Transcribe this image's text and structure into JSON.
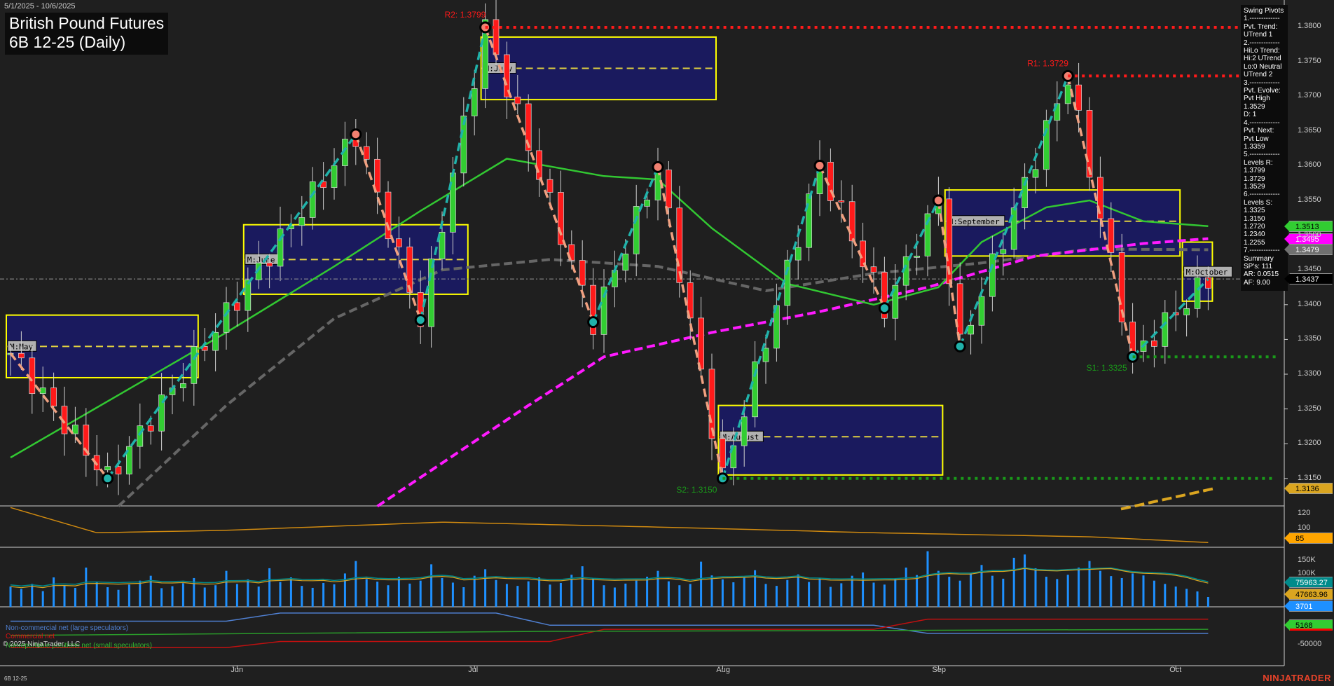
{
  "header": {
    "date_range": "5/1/2025 - 10/6/2025",
    "title_line1": "British Pound Futures",
    "title_line2": "6B 12-25 (Daily)"
  },
  "info_panel": [
    "Swing Pivots",
    "1.-------------",
    "Pvt. Trend:",
    "UTrend 1",
    "2.-------------",
    "HiLo Trend:",
    "Hi:2 UTrend",
    "Lo:0 Neutral",
    "UTrend 2",
    "3.-------------",
    "Pvt. Evolve:",
    "Pvt High",
    "1.3529",
    "D: 1",
    "4.-------------",
    "Pvt. Next:",
    "Pvt Low",
    "1.3359",
    "5.-------------",
    "Levels R:",
    "1.3799",
    "1.3729",
    "1.3529",
    "6.-------------",
    "Levels S:",
    "1.3325",
    "1.3150",
    "1.2720",
    "1.2340",
    "1.2255",
    "7.-------------",
    "Summary",
    "SP's: 111",
    "AR: 0.0515",
    "AF: 9.00"
  ],
  "price_tags": [
    {
      "label": "1.3513",
      "value": 1.3513,
      "bg": "#32cd32",
      "fg": "#000"
    },
    {
      "label": "1.3495",
      "value": 1.3495,
      "bg": "#ff00ff",
      "fg": "#fff"
    },
    {
      "label": "1.3479",
      "value": 1.3479,
      "bg": "#707070",
      "fg": "#fff"
    },
    {
      "label": "1.3437",
      "value": 1.3437,
      "bg": "#000000",
      "fg": "#fff"
    },
    {
      "label": "1.3136",
      "value": 1.3136,
      "bg": "#daa520",
      "fg": "#000"
    }
  ],
  "lower_tags": {
    "osc": "85",
    "vol1": "75963.27",
    "vol2": "47663.96",
    "vol3": "3701",
    "cot": "5168"
  },
  "lower_axis": {
    "osc": [
      "120",
      "100"
    ],
    "vol": [
      "150K",
      "100K"
    ],
    "cot": [
      "-50000"
    ]
  },
  "legend": {
    "noncomm": "Non-commercial net (large speculators)",
    "comm": "Commercial net",
    "nonrep": "Nonreportable positions net (small speculators)",
    "copyright": "© 2025 NinjaTrader, LLC"
  },
  "footer": {
    "symbol": "6B 12-25",
    "brand": "NINJATRADER"
  },
  "chart_data": {
    "type": "candlestick",
    "title": "British Pound Futures 6B 12-25 (Daily)",
    "ylim": [
      1.311,
      1.384
    ],
    "yticks": [
      "1.3800",
      "1.3750",
      "1.3700",
      "1.3650",
      "1.3600",
      "1.3550",
      "1.3500",
      "1.3450",
      "1.3400",
      "1.3350",
      "1.3300",
      "1.3250",
      "1.3200",
      "1.3150"
    ],
    "ytick_values": [
      1.38,
      1.375,
      1.37,
      1.365,
      1.36,
      1.355,
      1.35,
      1.345,
      1.34,
      1.335,
      1.33,
      1.325,
      1.32,
      1.315
    ],
    "bars": 112,
    "months": [
      {
        "label": "Jun",
        "bar": 21
      },
      {
        "label": "Jul",
        "bar": 43
      },
      {
        "label": "Aug",
        "bar": 66
      },
      {
        "label": "Sep",
        "bar": 86
      },
      {
        "label": "Oct",
        "bar": 108
      }
    ],
    "price_pivots": [
      [
        0,
        1.333
      ],
      [
        9,
        1.315
      ],
      [
        32,
        1.3645
      ],
      [
        38,
        1.3378
      ],
      [
        44,
        1.3799
      ],
      [
        54,
        1.3375
      ],
      [
        60,
        1.3598
      ],
      [
        66,
        1.315
      ],
      [
        75,
        1.36
      ],
      [
        81,
        1.3395
      ],
      [
        86,
        1.355
      ],
      [
        88,
        1.334
      ],
      [
        98,
        1.3729
      ],
      [
        104,
        1.3325
      ],
      [
        111,
        1.3437
      ]
    ],
    "levels": [
      {
        "label": "R2: 1.3799",
        "value": 1.3799,
        "from_bar": 44,
        "color": "#ff1a1a"
      },
      {
        "label": "R1: 1.3729",
        "value": 1.3729,
        "from_bar": 98,
        "color": "#ff1a1a"
      },
      {
        "label": "S1: 1.3325",
        "value": 1.3325,
        "from_bar": 104,
        "color": "#1a9a1a"
      },
      {
        "label": "S2: 1.3150",
        "value": 1.315,
        "from_bar": 66,
        "color": "#1a9a1a"
      }
    ],
    "monthly_boxes": [
      {
        "label": "M:May",
        "from": 0,
        "to": 17,
        "high": 1.3385,
        "low": 1.3295,
        "mid": 1.334
      },
      {
        "label": "M:June",
        "from": 22,
        "to": 42,
        "high": 1.3515,
        "low": 1.3415,
        "mid": 1.3465
      },
      {
        "label": "M:July",
        "from": 44,
        "to": 65,
        "high": 1.3785,
        "low": 1.3695,
        "mid": 1.374
      },
      {
        "label": "M:August",
        "from": 66,
        "to": 86,
        "high": 1.3255,
        "low": 1.3155,
        "mid": 1.321
      },
      {
        "label": "M:September",
        "from": 87,
        "to": 108,
        "high": 1.3565,
        "low": 1.347,
        "mid": 1.352
      },
      {
        "label": "M:October",
        "from": 109,
        "to": 111,
        "high": 1.349,
        "low": 1.3405,
        "mid": 1.3447
      }
    ],
    "ma_fast": [
      [
        0,
        1.318
      ],
      [
        10,
        1.327
      ],
      [
        20,
        1.336
      ],
      [
        30,
        1.3455
      ],
      [
        38,
        1.3535
      ],
      [
        46,
        1.361
      ],
      [
        55,
        1.3585
      ],
      [
        60,
        1.358
      ],
      [
        65,
        1.351
      ],
      [
        72,
        1.343
      ],
      [
        80,
        1.34
      ],
      [
        86,
        1.3425
      ],
      [
        90,
        1.349
      ],
      [
        96,
        1.354
      ],
      [
        100,
        1.355
      ],
      [
        105,
        1.352
      ],
      [
        111,
        1.3513
      ]
    ],
    "ma_mid": [
      [
        10,
        1.311
      ],
      [
        20,
        1.3255
      ],
      [
        30,
        1.338
      ],
      [
        40,
        1.345
      ],
      [
        50,
        1.3465
      ],
      [
        60,
        1.3455
      ],
      [
        70,
        1.342
      ],
      [
        80,
        1.3445
      ],
      [
        90,
        1.346
      ],
      [
        100,
        1.348
      ],
      [
        111,
        1.3479
      ]
    ],
    "ma_slow": [
      [
        34,
        1.311
      ],
      [
        48,
        1.3255
      ],
      [
        55,
        1.3325
      ],
      [
        65,
        1.336
      ],
      [
        75,
        1.339
      ],
      [
        85,
        1.3425
      ],
      [
        95,
        1.347
      ],
      [
        105,
        1.3488
      ],
      [
        111,
        1.3495
      ]
    ],
    "oscillator": [
      [
        0,
        128
      ],
      [
        8,
        97
      ],
      [
        20,
        100
      ],
      [
        40,
        110
      ],
      [
        60,
        104
      ],
      [
        80,
        97
      ],
      [
        100,
        92
      ],
      [
        111,
        85
      ]
    ],
    "osc_ylim": [
      80,
      130
    ],
    "volume": [
      62,
      55,
      70,
      48,
      90,
      66,
      58,
      120,
      75,
      60,
      52,
      68,
      80,
      95,
      57,
      63,
      72,
      88,
      59,
      66,
      110,
      70,
      84,
      62,
      118,
      76,
      90,
      64,
      58,
      73,
      69,
      102,
      140,
      85,
      77,
      66,
      92,
      71,
      80,
      130,
      88,
      74,
      60,
      95,
      115,
      82,
      70,
      64,
      78,
      90,
      68,
      73,
      98,
      124,
      87,
      66,
      59,
      71,
      80,
      92,
      110,
      78,
      66,
      70,
      138,
      96,
      84,
      75,
      90,
      112,
      70,
      64,
      82,
      99,
      76,
      88,
      61,
      72,
      95,
      105,
      74,
      68,
      85,
      120,
      97,
      170,
      110,
      92,
      80,
      104,
      128,
      95,
      86,
      150,
      160,
      118,
      92,
      85,
      98,
      120,
      140,
      110,
      94,
      88,
      102,
      96,
      80,
      70,
      62,
      55,
      47,
      30
    ],
    "vol_ylim": [
      0,
      180
    ],
    "cot_series": [
      {
        "name": "Non-commercial net (large speculators)",
        "color": "#4f7fd0",
        "points": [
          [
            0,
            0.25
          ],
          [
            20,
            0.25
          ],
          [
            25,
            0.05
          ],
          [
            45,
            0.05
          ],
          [
            50,
            0.35
          ],
          [
            80,
            0.35
          ],
          [
            85,
            0.55
          ],
          [
            111,
            0.55
          ]
        ]
      },
      {
        "name": "Commercial net",
        "color": "#c01010",
        "points": [
          [
            0,
            0.9
          ],
          [
            20,
            0.9
          ],
          [
            25,
            0.75
          ],
          [
            50,
            0.75
          ],
          [
            55,
            0.45
          ],
          [
            80,
            0.45
          ],
          [
            85,
            0.2
          ],
          [
            111,
            0.2
          ]
        ]
      },
      {
        "name": "Nonreportable positions net (small speculators)",
        "color": "#2a9a2a",
        "points": [
          [
            0,
            0.6
          ],
          [
            25,
            0.55
          ],
          [
            50,
            0.5
          ],
          [
            80,
            0.48
          ],
          [
            111,
            0.45
          ]
        ]
      }
    ]
  }
}
